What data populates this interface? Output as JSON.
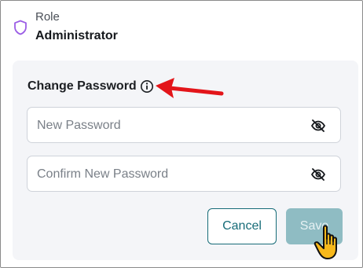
{
  "role": {
    "label": "Role",
    "value": "Administrator",
    "icon": "shield-icon"
  },
  "change_password": {
    "title": "Change Password",
    "info_icon": "info-icon",
    "new_password": {
      "value": "",
      "placeholder": "New Password",
      "toggle_icon": "eye-slash-icon"
    },
    "confirm_password": {
      "value": "",
      "placeholder": "Confirm New Password",
      "toggle_icon": "eye-slash-icon"
    },
    "cancel_label": "Cancel",
    "save_label": "Save"
  },
  "colors": {
    "shield": "#9b5de5",
    "accent": "#176c78",
    "save_disabled": "#8fbcc3",
    "annotation_arrow": "#e3151a",
    "card_background": "#f4f5f8"
  }
}
